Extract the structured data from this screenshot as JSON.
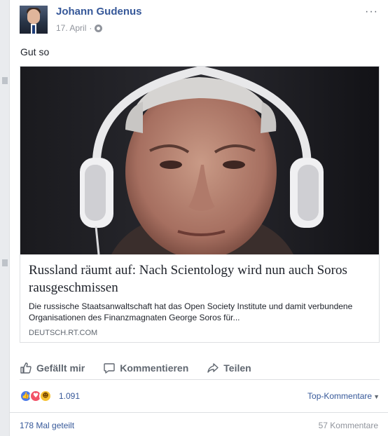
{
  "post": {
    "author": "Johann Gudenus",
    "date": "17. April",
    "separator": "·",
    "privacy_icon": "globe-icon",
    "more_label": "···",
    "status_text": "Gut so"
  },
  "link": {
    "title": "Russland räumt auf: Nach Scientology wird nun auch Soros rausgeschmissen",
    "description": "Die russische Staatsanwaltschaft hat das Open Society Institute und damit verbundene Organisationen des Finanzmagnaten George Soros für...",
    "domain": "DEUTSCH.RT.COM"
  },
  "actions": {
    "like": "Gefällt mir",
    "comment": "Kommentieren",
    "share": "Teilen"
  },
  "reactions": {
    "types": [
      "like-icon",
      "love-icon",
      "haha-icon"
    ],
    "count": "1.091",
    "sort_label": "Top-Kommentare"
  },
  "footer": {
    "shares": "178 Mal geteilt",
    "comments": "57 Kommentare"
  },
  "colors": {
    "link_blue": "#365899",
    "secondary": "#606770",
    "muted": "#90949c"
  }
}
